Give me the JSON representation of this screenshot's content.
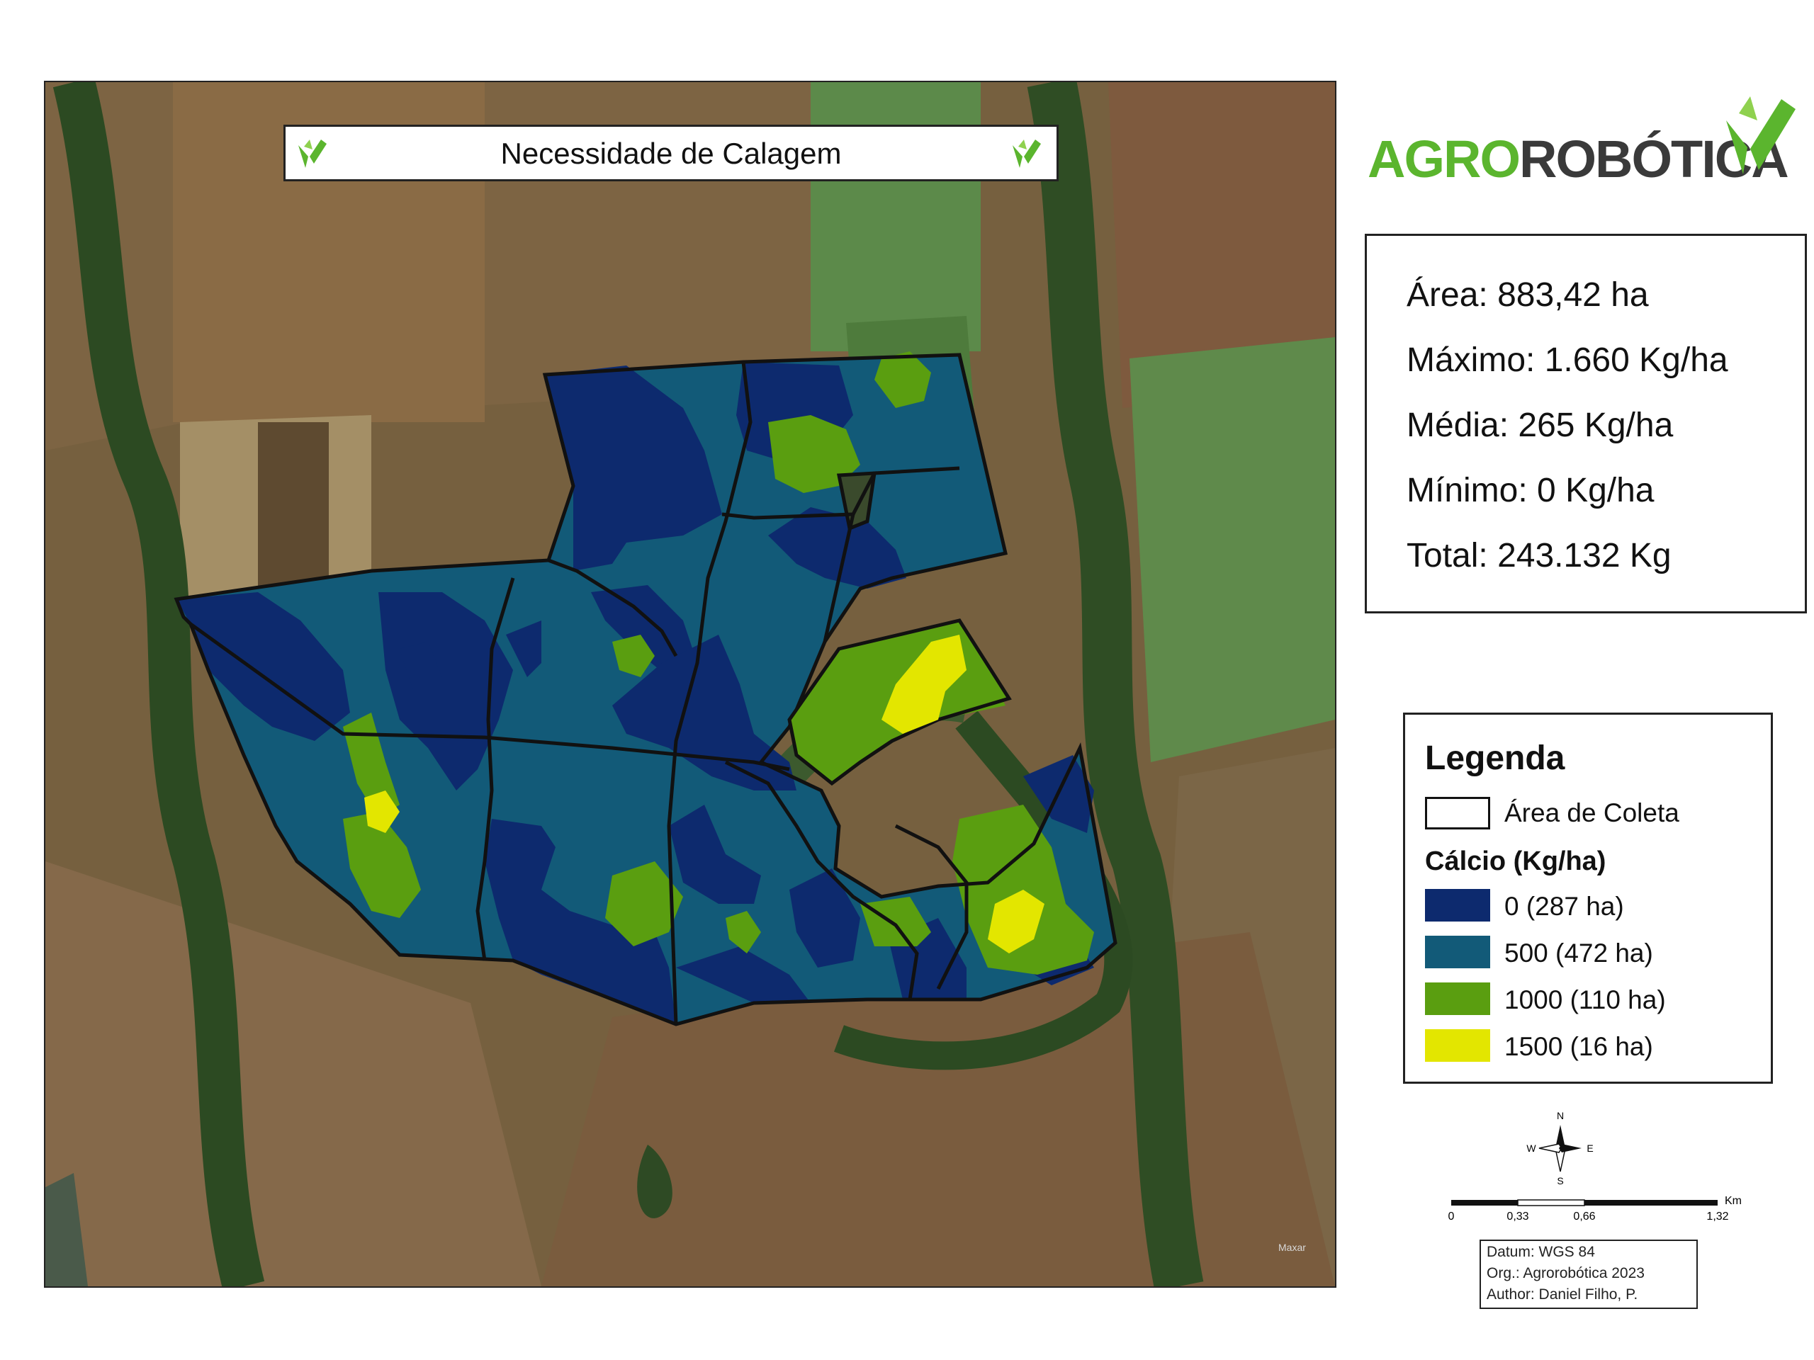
{
  "map": {
    "title": "Necessidade de Calagem",
    "watermark": "Maxar",
    "colors": {
      "class_0": "#0d2a6e",
      "class_500": "#125a78",
      "class_1000": "#5a9e10",
      "class_1500": "#e3e600",
      "boundary": "#111111"
    }
  },
  "brand": {
    "agro": "AGRO",
    "robotica": "ROBÓTICA",
    "colors": {
      "green": "#5bb52e",
      "dark": "#3a3a3a"
    }
  },
  "stats": {
    "area": "Área: 883,42 ha",
    "maximo": "Máximo: 1.660 Kg/ha",
    "media": "Média: 265 Kg/ha",
    "minimo": "Mínimo: 0 Kg/ha",
    "total": "Total: 243.132 Kg"
  },
  "legend": {
    "title": "Legenda",
    "boundary_label": "Área de Coleta",
    "subtitle": "Cálcio (Kg/ha)",
    "classes": [
      {
        "label": "0  (287 ha)",
        "color": "#0d2a6e"
      },
      {
        "label": "500  (472 ha)",
        "color": "#125a78"
      },
      {
        "label": "1000  (110 ha)",
        "color": "#5a9e10"
      },
      {
        "label": "1500  (16 ha)",
        "color": "#e3e600"
      }
    ]
  },
  "compass": {
    "n": "N",
    "s": "S",
    "e": "E",
    "w": "W",
    "icon": "north-arrow-icon"
  },
  "scale": {
    "unit": "Km",
    "ticks": [
      "0",
      "0,33",
      "0,66",
      "1,32"
    ]
  },
  "info": {
    "datum": "Datum: WGS 84",
    "org": "Org.: Agrorobótica 2023",
    "author": "Author: Daniel Filho, P."
  }
}
